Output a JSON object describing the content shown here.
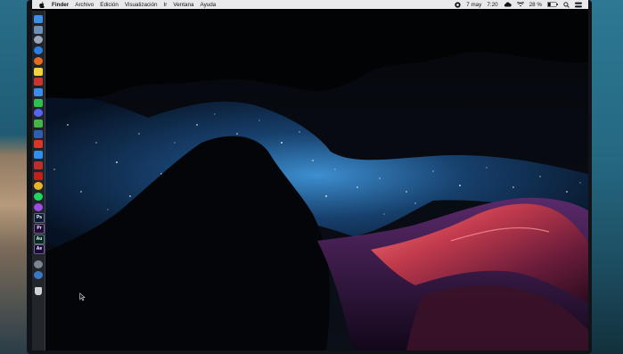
{
  "menubar": {
    "apple_icon": "apple-logo-icon",
    "app_name": "Finder",
    "items": [
      "Archivo",
      "Edición",
      "Visualización",
      "Ir",
      "Ventana",
      "Ayuda"
    ],
    "date": "7 may",
    "time": "7:20",
    "battery": "28 %",
    "status_icons": [
      "screen-record-icon",
      "cloud-icon",
      "wifi-icon",
      "battery-icon",
      "search-icon",
      "control-center-icon"
    ]
  },
  "dock": {
    "icons": [
      {
        "name": "finder-icon",
        "color": "#3a8ee6"
      },
      {
        "name": "preview-icon",
        "color": "#6e8fb4"
      },
      {
        "name": "launchpad-icon",
        "color": "#9aa6b8"
      },
      {
        "name": "safari-icon",
        "color": "#2b7fe0"
      },
      {
        "name": "firefox-icon",
        "color": "#e76a1f"
      },
      {
        "name": "notes-icon",
        "color": "#f1d23f"
      },
      {
        "name": "photo-booth-icon",
        "color": "#c9362f"
      },
      {
        "name": "messenger-icon",
        "color": "#3b8df0"
      },
      {
        "name": "whatsapp-icon",
        "color": "#2fbf4e"
      },
      {
        "name": "discord-icon",
        "color": "#5865f2"
      },
      {
        "name": "wechat-icon",
        "color": "#43b649"
      },
      {
        "name": "word-icon",
        "color": "#2b5fb3"
      },
      {
        "name": "mail-icon",
        "color": "#d9362b"
      },
      {
        "name": "app-store-icon",
        "color": "#2e8ff0"
      },
      {
        "name": "filezilla-icon",
        "color": "#b7322c"
      },
      {
        "name": "acrobat-icon",
        "color": "#c4201a"
      },
      {
        "name": "chrome-icon",
        "color": "#e7b52a"
      },
      {
        "name": "spotify-icon",
        "color": "#1ed760"
      },
      {
        "name": "podcasts-icon",
        "color": "#9b4ee0"
      },
      {
        "name": "photoshop-icon",
        "color": "#0b1b34",
        "label": "Ps"
      },
      {
        "name": "premiere-icon",
        "color": "#240b3a",
        "label": "Pr"
      },
      {
        "name": "audition-icon",
        "color": "#062a24",
        "label": "Au"
      },
      {
        "name": "after-effects-icon",
        "color": "#1c0a3e",
        "label": "Ae"
      },
      {
        "name": "system-preferences-icon",
        "color": "#7d8590"
      },
      {
        "name": "downloads-icon",
        "color": "#3b78c4"
      },
      {
        "name": "trash-icon",
        "color": "#cfd3d8"
      }
    ]
  },
  "desktop": {
    "wallpaper": "milky-way-canyon-wallpaper",
    "cursor_icon": "mouse-pointer-icon"
  },
  "colors": {
    "menubar_bg": "#e9e9eb",
    "sky_glow": "#2f78b8",
    "canyon_red": "#c83f4e"
  }
}
